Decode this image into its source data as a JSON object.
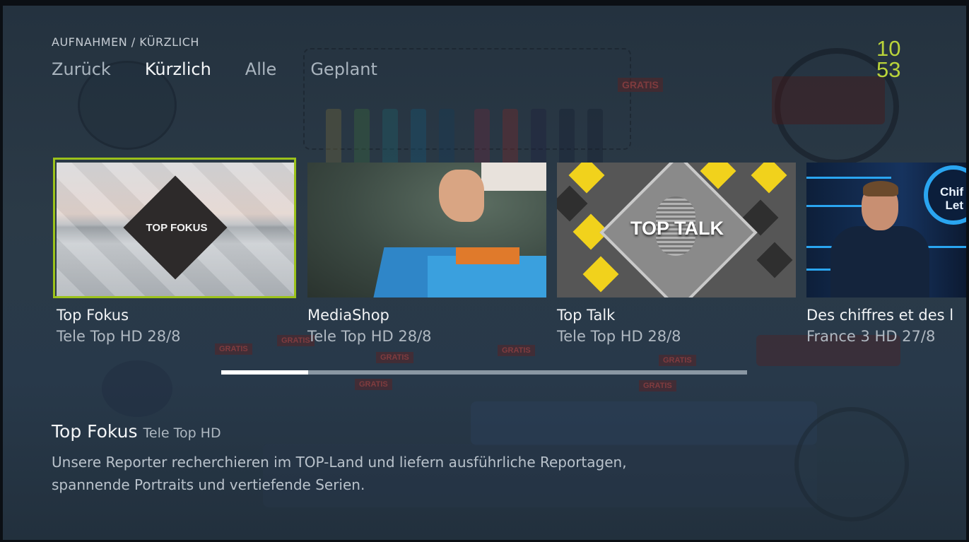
{
  "header": {
    "breadcrumb": "AUFNAHMEN / KÜRZLICH",
    "clock_hours": "10",
    "clock_minutes": "53"
  },
  "nav": {
    "items": [
      {
        "label": "Zurück"
      },
      {
        "label": "Kürzlich",
        "active": true
      },
      {
        "label": "Alle"
      },
      {
        "label": "Geplant"
      }
    ]
  },
  "recordings": [
    {
      "title": "Top Fokus",
      "channel_date": "Tele Top HD  28/8",
      "thumb_label": "TOP FOKUS",
      "selected": true
    },
    {
      "title": "MediaShop",
      "channel_date": "Tele Top HD  28/8"
    },
    {
      "title": "Top Talk",
      "channel_date": "Tele Top HD  28/8",
      "thumb_label": "TOP TALK"
    },
    {
      "title": "Des chiffres et des l",
      "channel_date": "France 3 HD  27/8",
      "thumb_label": "Chif Let"
    }
  ],
  "progress": {
    "fraction": 0.165
  },
  "details": {
    "title": "Top Fokus",
    "channel": "Tele Top HD",
    "description": "Unsere Reporter recherchieren im TOP-Land und liefern ausführliche Reportagen, spannende Portraits und vertiefende Serien."
  },
  "colors": {
    "accent": "#9cc21a",
    "clock": "#b9d33a",
    "background": "#2b3a47"
  }
}
